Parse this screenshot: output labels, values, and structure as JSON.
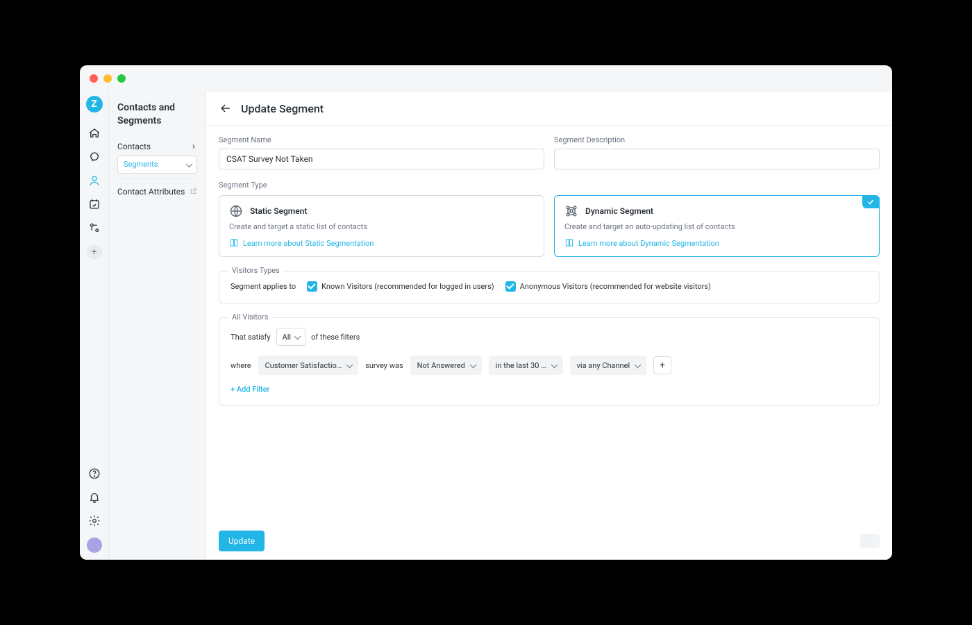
{
  "sidebar_title": "Contacts and Segments",
  "nav": {
    "contacts": "Contacts",
    "segments": "Segments",
    "contact_attributes": "Contact Attributes"
  },
  "page": {
    "title": "Update Segment",
    "name_label": "Segment Name",
    "name_value": "CSAT Survey Not Taken",
    "desc_label": "Segment Description",
    "desc_value": "",
    "type_label": "Segment Type"
  },
  "segment_types": {
    "static": {
      "title": "Static Segment",
      "desc": "Create and target a static list of contacts",
      "learn": "Learn more about Static Segmentation"
    },
    "dynamic": {
      "title": "Dynamic Segment",
      "desc": "Create and target an auto-updating list of contacts",
      "learn": "Learn more about Dynamic Segmentation",
      "selected": true
    }
  },
  "visitors": {
    "legend": "Visitors Types",
    "applies_label": "Segment applies to",
    "known": "Known Visitors (recommended for logged in users)",
    "anonymous": "Anonymous Visitors (recommended for website visitors)"
  },
  "allvisitors": {
    "legend": "All Visitors",
    "satisfy_pre": "That satisfy",
    "satisfy_sel": "All",
    "satisfy_post": "of these filters",
    "line": {
      "where": "where",
      "attr": "Customer Satisfactio…",
      "mid": "survey was",
      "cond": "Not Answered",
      "time": "in the last 30 …",
      "channel": "via any Channel"
    },
    "add_filter": "+ Add Filter"
  },
  "footer": {
    "update": "Update"
  },
  "colors": {
    "accent": "#21b6e6"
  }
}
